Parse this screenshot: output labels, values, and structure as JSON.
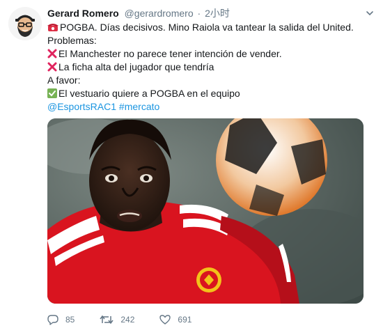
{
  "tweet": {
    "author_name": "Gerard Romero",
    "author_handle": "@gerardromero",
    "separator": "·",
    "timestamp": "2小时",
    "lines": [
      "POGBA. Días decisivos. Mino Raiola va tantear la salida del United.",
      "Problemas:",
      "El Manchester no parece tener intención de vender.",
      "La ficha alta del jugador que tendría",
      "A favor:",
      "El vestuario quiere a POGBA en el equipo"
    ],
    "mentions": [
      "@EsportsRAC1",
      "#mercato"
    ],
    "icons": {
      "line0": "telephone-icon",
      "line2": "red-cross-icon",
      "line3": "red-cross-icon",
      "line5": "green-check-icon"
    },
    "colors": {
      "link": "#1b95e0",
      "muted": "#657786",
      "cross": "#e0245e",
      "check": "#77b255"
    }
  },
  "actions": {
    "reply_count": "85",
    "retweet_count": "242",
    "like_count": "691"
  }
}
